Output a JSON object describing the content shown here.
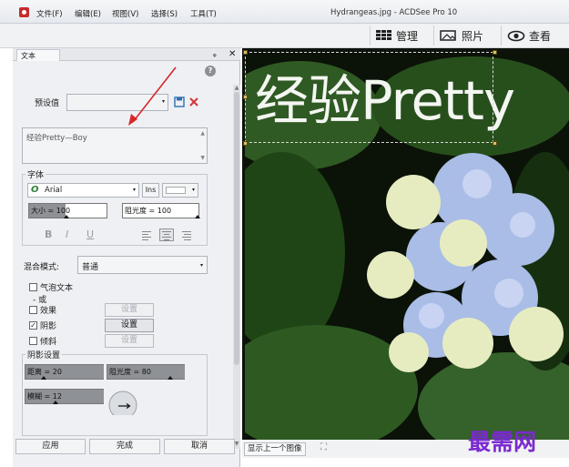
{
  "titlebar": {
    "menus": [
      "文件(F)",
      "编辑(E)",
      "视图(V)",
      "选择(S)",
      "工具(T)"
    ],
    "title": "Hydrangeas.jpg - ACDSee Pro 10"
  },
  "modes": {
    "manage": "管理",
    "photos": "照片",
    "view": "查看"
  },
  "panel": {
    "tab": "文本",
    "preset_label": "预设值",
    "preset_value": "",
    "text_value": "经验Pretty—Boy",
    "font_group": "字体",
    "font_name": "Arial",
    "ins": "Ins",
    "size_text": "大小 = 100",
    "opacity_text": "阻光度 = 100",
    "bold": "B",
    "italic": "I",
    "underline": "U",
    "blend_label": "混合模式:",
    "blend_value": "普通",
    "bubble_text": "气泡文本",
    "or_text": "- 或",
    "effect": "效果",
    "shadow": "阴影",
    "tilt": "倾斜",
    "setting": "设置",
    "shadow_group": "阴影设置",
    "distance_text": "距离 = 20",
    "shadow_opacity_text": "阻光度 = 80",
    "blur_text": "模糊 = 12"
  },
  "bottom": {
    "apply": "应用",
    "done": "完成",
    "cancel": "取消"
  },
  "status": {
    "prev": "显示上一个图像"
  },
  "image": {
    "overlay_text": "经验Pretty"
  },
  "watermark": "最需网"
}
